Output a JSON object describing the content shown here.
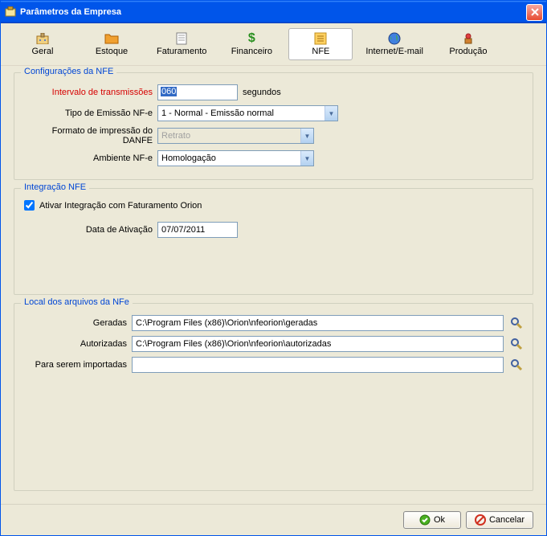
{
  "window": {
    "title": "Parâmetros da Empresa"
  },
  "tabs": [
    {
      "label": "Geral",
      "icon": "office"
    },
    {
      "label": "Estoque",
      "icon": "folder"
    },
    {
      "label": "Faturamento",
      "icon": "doc"
    },
    {
      "label": "Financeiro",
      "icon": "money"
    },
    {
      "label": "NFE",
      "icon": "nfe"
    },
    {
      "label": "Internet/E-mail",
      "icon": "globe"
    },
    {
      "label": "Produção",
      "icon": "gear"
    }
  ],
  "groups": {
    "config": {
      "legend": "Configurações da NFE",
      "interval_label": "Intervalo de transmissões",
      "interval_value": "060",
      "interval_unit": "segundos",
      "tipo_label": "Tipo de Emissão NF-e",
      "tipo_value": "1 - Normal - Emissão normal",
      "formato_label": "Formato de impressão do DANFE",
      "formato_value": "Retrato",
      "ambiente_label": "Ambiente NF-e",
      "ambiente_value": "Homologação"
    },
    "integracao": {
      "legend": "Integração NFE",
      "checkbox_label": "Ativar Integração com Faturamento Orion",
      "data_label": "Data de Ativação",
      "data_value": "07/07/2011"
    },
    "local": {
      "legend": "Local dos arquivos da NFe",
      "geradas_label": "Geradas",
      "geradas_value": "C:\\Program Files (x86)\\Orion\\nfeorion\\geradas",
      "autorizadas_label": "Autorizadas",
      "autorizadas_value": "C:\\Program Files (x86)\\Orion\\nfeorion\\autorizadas",
      "para_label": "Para serem importadas",
      "para_value": ""
    }
  },
  "buttons": {
    "ok": "Ok",
    "cancel": "Cancelar"
  }
}
